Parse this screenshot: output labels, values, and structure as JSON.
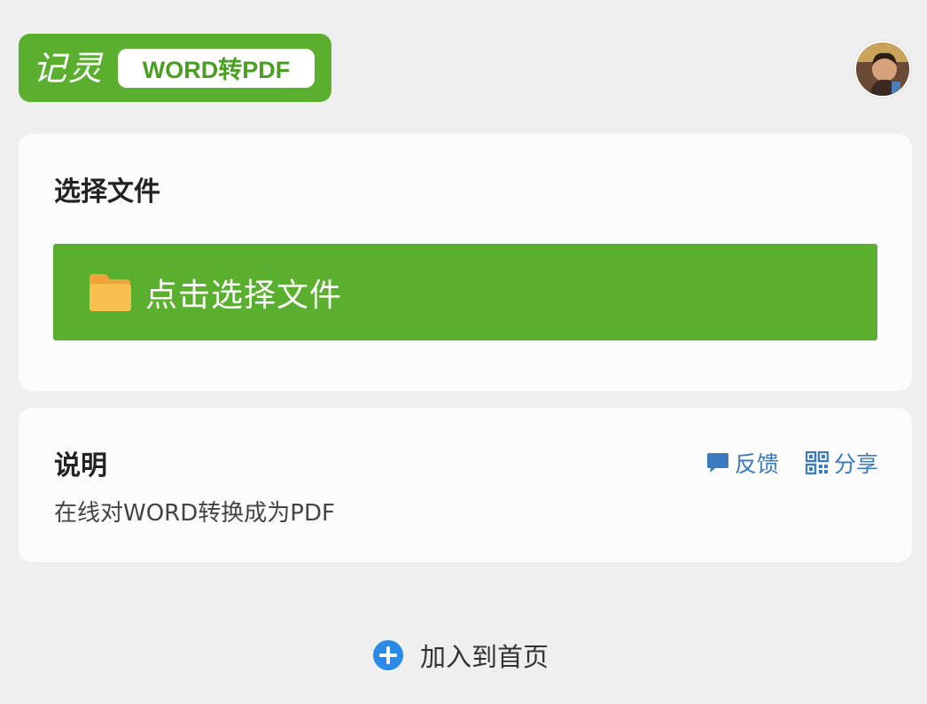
{
  "header": {
    "brand_name": "记灵",
    "brand_badge": "WORD转PDF"
  },
  "select_card": {
    "title": "选择文件",
    "button_label": "点击选择文件"
  },
  "info_card": {
    "title": "说明",
    "description": "在线对WORD转换成为PDF",
    "feedback_label": "反馈",
    "share_label": "分享"
  },
  "footer": {
    "add_home_label": "加入到首页"
  },
  "colors": {
    "brand_green": "#5aaf2e",
    "link_blue": "#3a7ac0",
    "folder_yellow": "#f5b541",
    "plus_blue": "#2b8ae6",
    "background": "#efefef"
  },
  "icons": [
    "folder-icon",
    "chat-bubble-icon",
    "qr-code-icon",
    "plus-circle-icon",
    "avatar"
  ]
}
